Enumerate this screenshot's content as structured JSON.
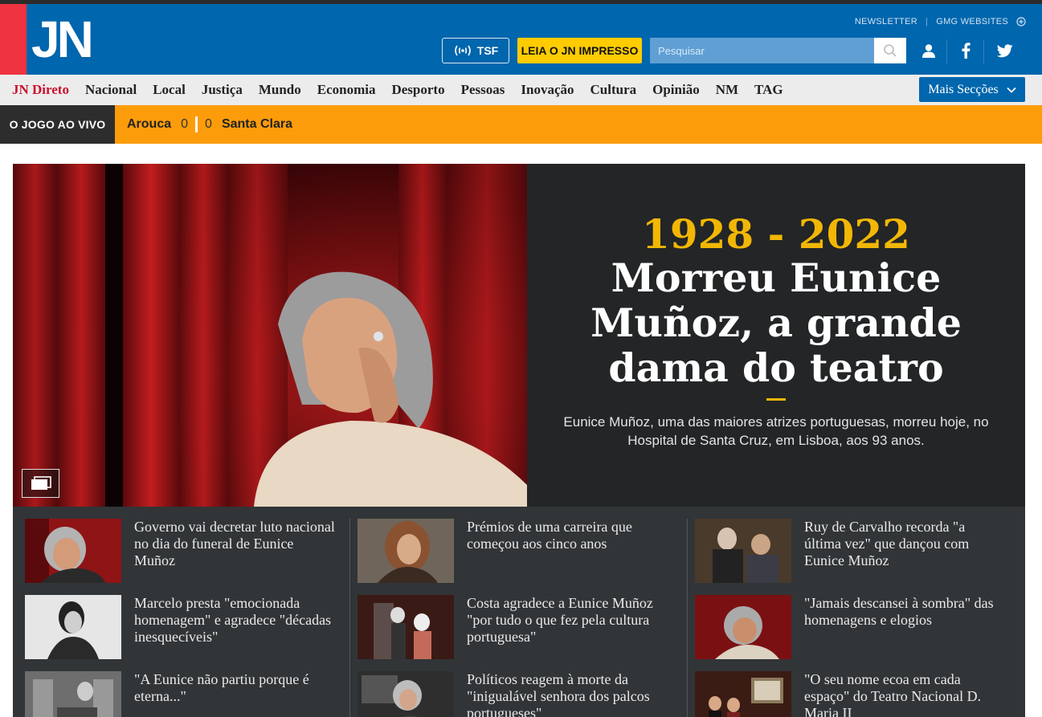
{
  "header": {
    "logo": "JN",
    "newsletter": "NEWSLETTER",
    "gmg": "GMG WEBSITES",
    "tsf": "TSF",
    "leia": "LEIA O JN IMPRESSO",
    "search_placeholder": "Pesquisar"
  },
  "nav": {
    "items": [
      "JN Direto",
      "Nacional",
      "Local",
      "Justiça",
      "Mundo",
      "Economia",
      "Desporto",
      "Pessoas",
      "Inovação",
      "Cultura",
      "Opinião",
      "NM",
      "TAG"
    ],
    "mais": "Mais Secções"
  },
  "live": {
    "tag": "O JOGO AO VIVO",
    "home": "Arouca",
    "home_score": "0",
    "away_score": "0",
    "away": "Santa Clara"
  },
  "hero": {
    "years": "1928 - 2022",
    "headline": "Morreu Eunice Muñoz, a grande dama do teatro",
    "lead": "Eunice Muñoz, uma das maiores atrizes portuguesas, morreu hoje, no Hospital de Santa Cruz, em Lisboa, aos 93 anos."
  },
  "related": [
    {
      "title": "Governo vai decretar luto nacional no dia do funeral de Eunice Muñoz"
    },
    {
      "title": "Prémios de uma carreira que começou aos cinco anos"
    },
    {
      "title": "Ruy de Carvalho recorda \"a última vez\" que dançou com Eunice Muñoz"
    },
    {
      "title": "Marcelo presta \"emocionada homenagem\" e agradece \"décadas inesquecíveis\""
    },
    {
      "title": "Costa agradece a Eunice Muñoz \"por tudo o que fez pela cultura portuguesa\""
    },
    {
      "title": "\"Jamais descansei à sombra\" das homenagens e elogios"
    },
    {
      "title": "\"A Eunice não partiu porque é eterna...\""
    },
    {
      "title": "Políticos reagem à morte da \"inigualável senhora dos palcos portugueses\""
    },
    {
      "title": "\"O seu nome ecoa em cada espaço\" do Teatro Nacional D. Maria II"
    }
  ]
}
